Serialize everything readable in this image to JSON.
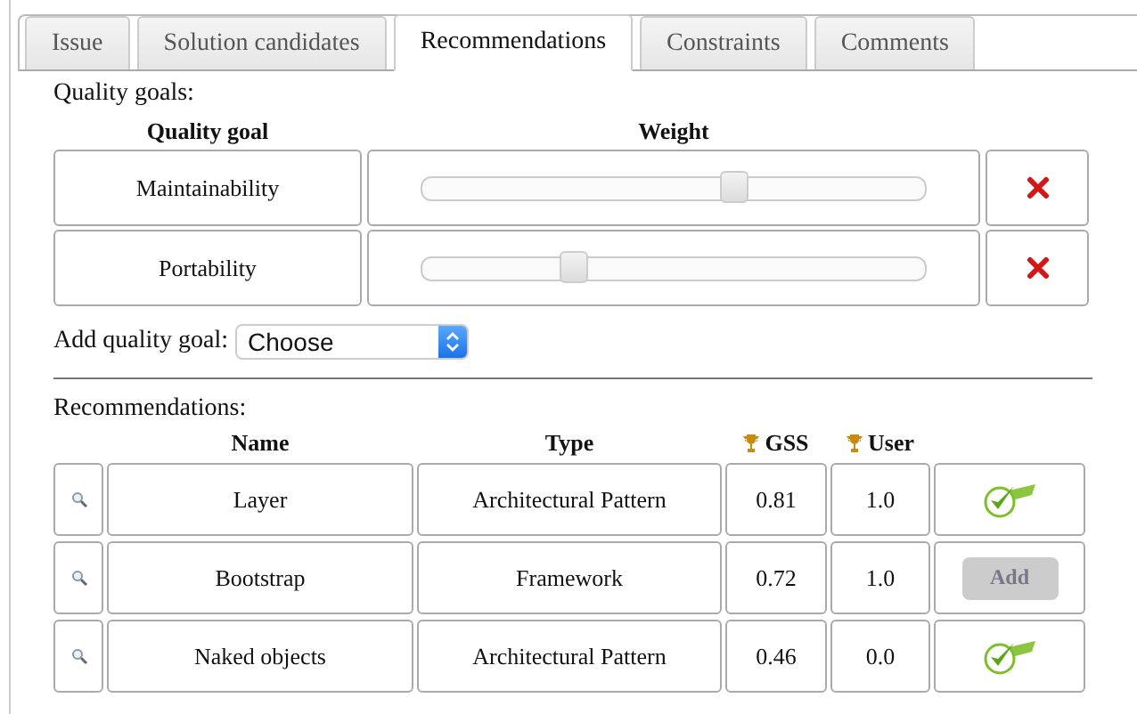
{
  "tabs": [
    {
      "label": "Issue",
      "selected": false
    },
    {
      "label": "Solution candidates",
      "selected": false
    },
    {
      "label": "Recommendations",
      "selected": true
    },
    {
      "label": "Constraints",
      "selected": false
    },
    {
      "label": "Comments",
      "selected": false
    }
  ],
  "quality_goals": {
    "title": "Quality goals:",
    "columns": [
      "Quality goal",
      "Weight"
    ],
    "rows": [
      {
        "name": "Maintainability",
        "level": 0.62
      },
      {
        "name": "Portability",
        "level": 0.3
      }
    ]
  },
  "add_goal": {
    "label": "Add quality goal:",
    "value": "Choose"
  },
  "recommendations": {
    "title": "Recommendations:",
    "columns": [
      "Name",
      "Type",
      "GSS",
      "User"
    ],
    "rows": [
      {
        "name": "Layer",
        "type": "Architectural Pattern",
        "gss": "0.81",
        "user": "1.0",
        "kind": "added"
      },
      {
        "name": "Bootstrap",
        "type": "Framework",
        "gss": "0.72",
        "user": "1.0",
        "kind": "add",
        "action": "Add"
      },
      {
        "name": "Naked objects",
        "type": "Architectural Pattern",
        "gss": "0.46",
        "user": "0.0",
        "kind": "added"
      }
    ]
  }
}
